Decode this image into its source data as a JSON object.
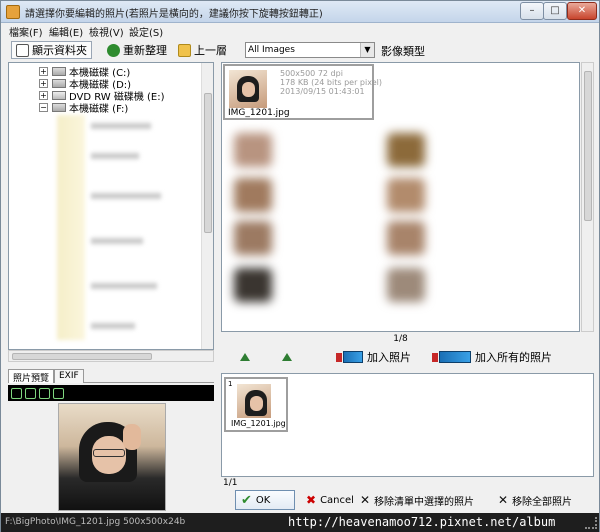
{
  "window": {
    "title": "請選擇你要編輯的照片(若照片是橫向的，建議你按下旋轉按鈕轉正)",
    "controls": {
      "minimize": "–",
      "maximize": "□",
      "close": "✕"
    }
  },
  "menu": [
    "檔案(F)",
    "編輯(E)",
    "檢視(V)",
    "設定(S)"
  ],
  "toolbar": {
    "show_folders": "顯示資料夾",
    "refresh": "重新整理",
    "up_one_level": "上一層",
    "filter_value": "All Images",
    "filter_label": "影像類型"
  },
  "tree": {
    "items": [
      {
        "label": "本機磁碟 (C:)",
        "expander": "+"
      },
      {
        "label": "本機磁碟 (D:)",
        "expander": "+"
      },
      {
        "label": "DVD RW 磁碟機 (E:)",
        "expander": "+"
      },
      {
        "label": "本機磁碟 (F:)",
        "expander": "−"
      }
    ]
  },
  "preview": {
    "tabs": [
      "照片預覽",
      "EXIF"
    ]
  },
  "grid": {
    "selected_item": {
      "name": "IMG_1201.jpg",
      "dimensions": "500x500 72 dpi",
      "size": "178 KB (24 bits per pixel)",
      "date": "2013/09/15 01:43:01"
    },
    "page": "1/8"
  },
  "actions": {
    "add_photo": "加入照片",
    "add_all_photos": "加入所有的照片"
  },
  "selected_list": {
    "items": [
      {
        "index": "1",
        "name": "IMG_1201.jpg"
      }
    ],
    "count": "1/1"
  },
  "buttons": {
    "ok": "OK",
    "cancel": "Cancel",
    "remove_selected": "移除清單中選擇的照片",
    "remove_all": "移除全部照片"
  },
  "status": {
    "path_info": "F:\\BigPhoto\\IMG_1201.jpg    500x500x24b",
    "watermark": "http://heavenamoo712.pixnet.net/album"
  }
}
